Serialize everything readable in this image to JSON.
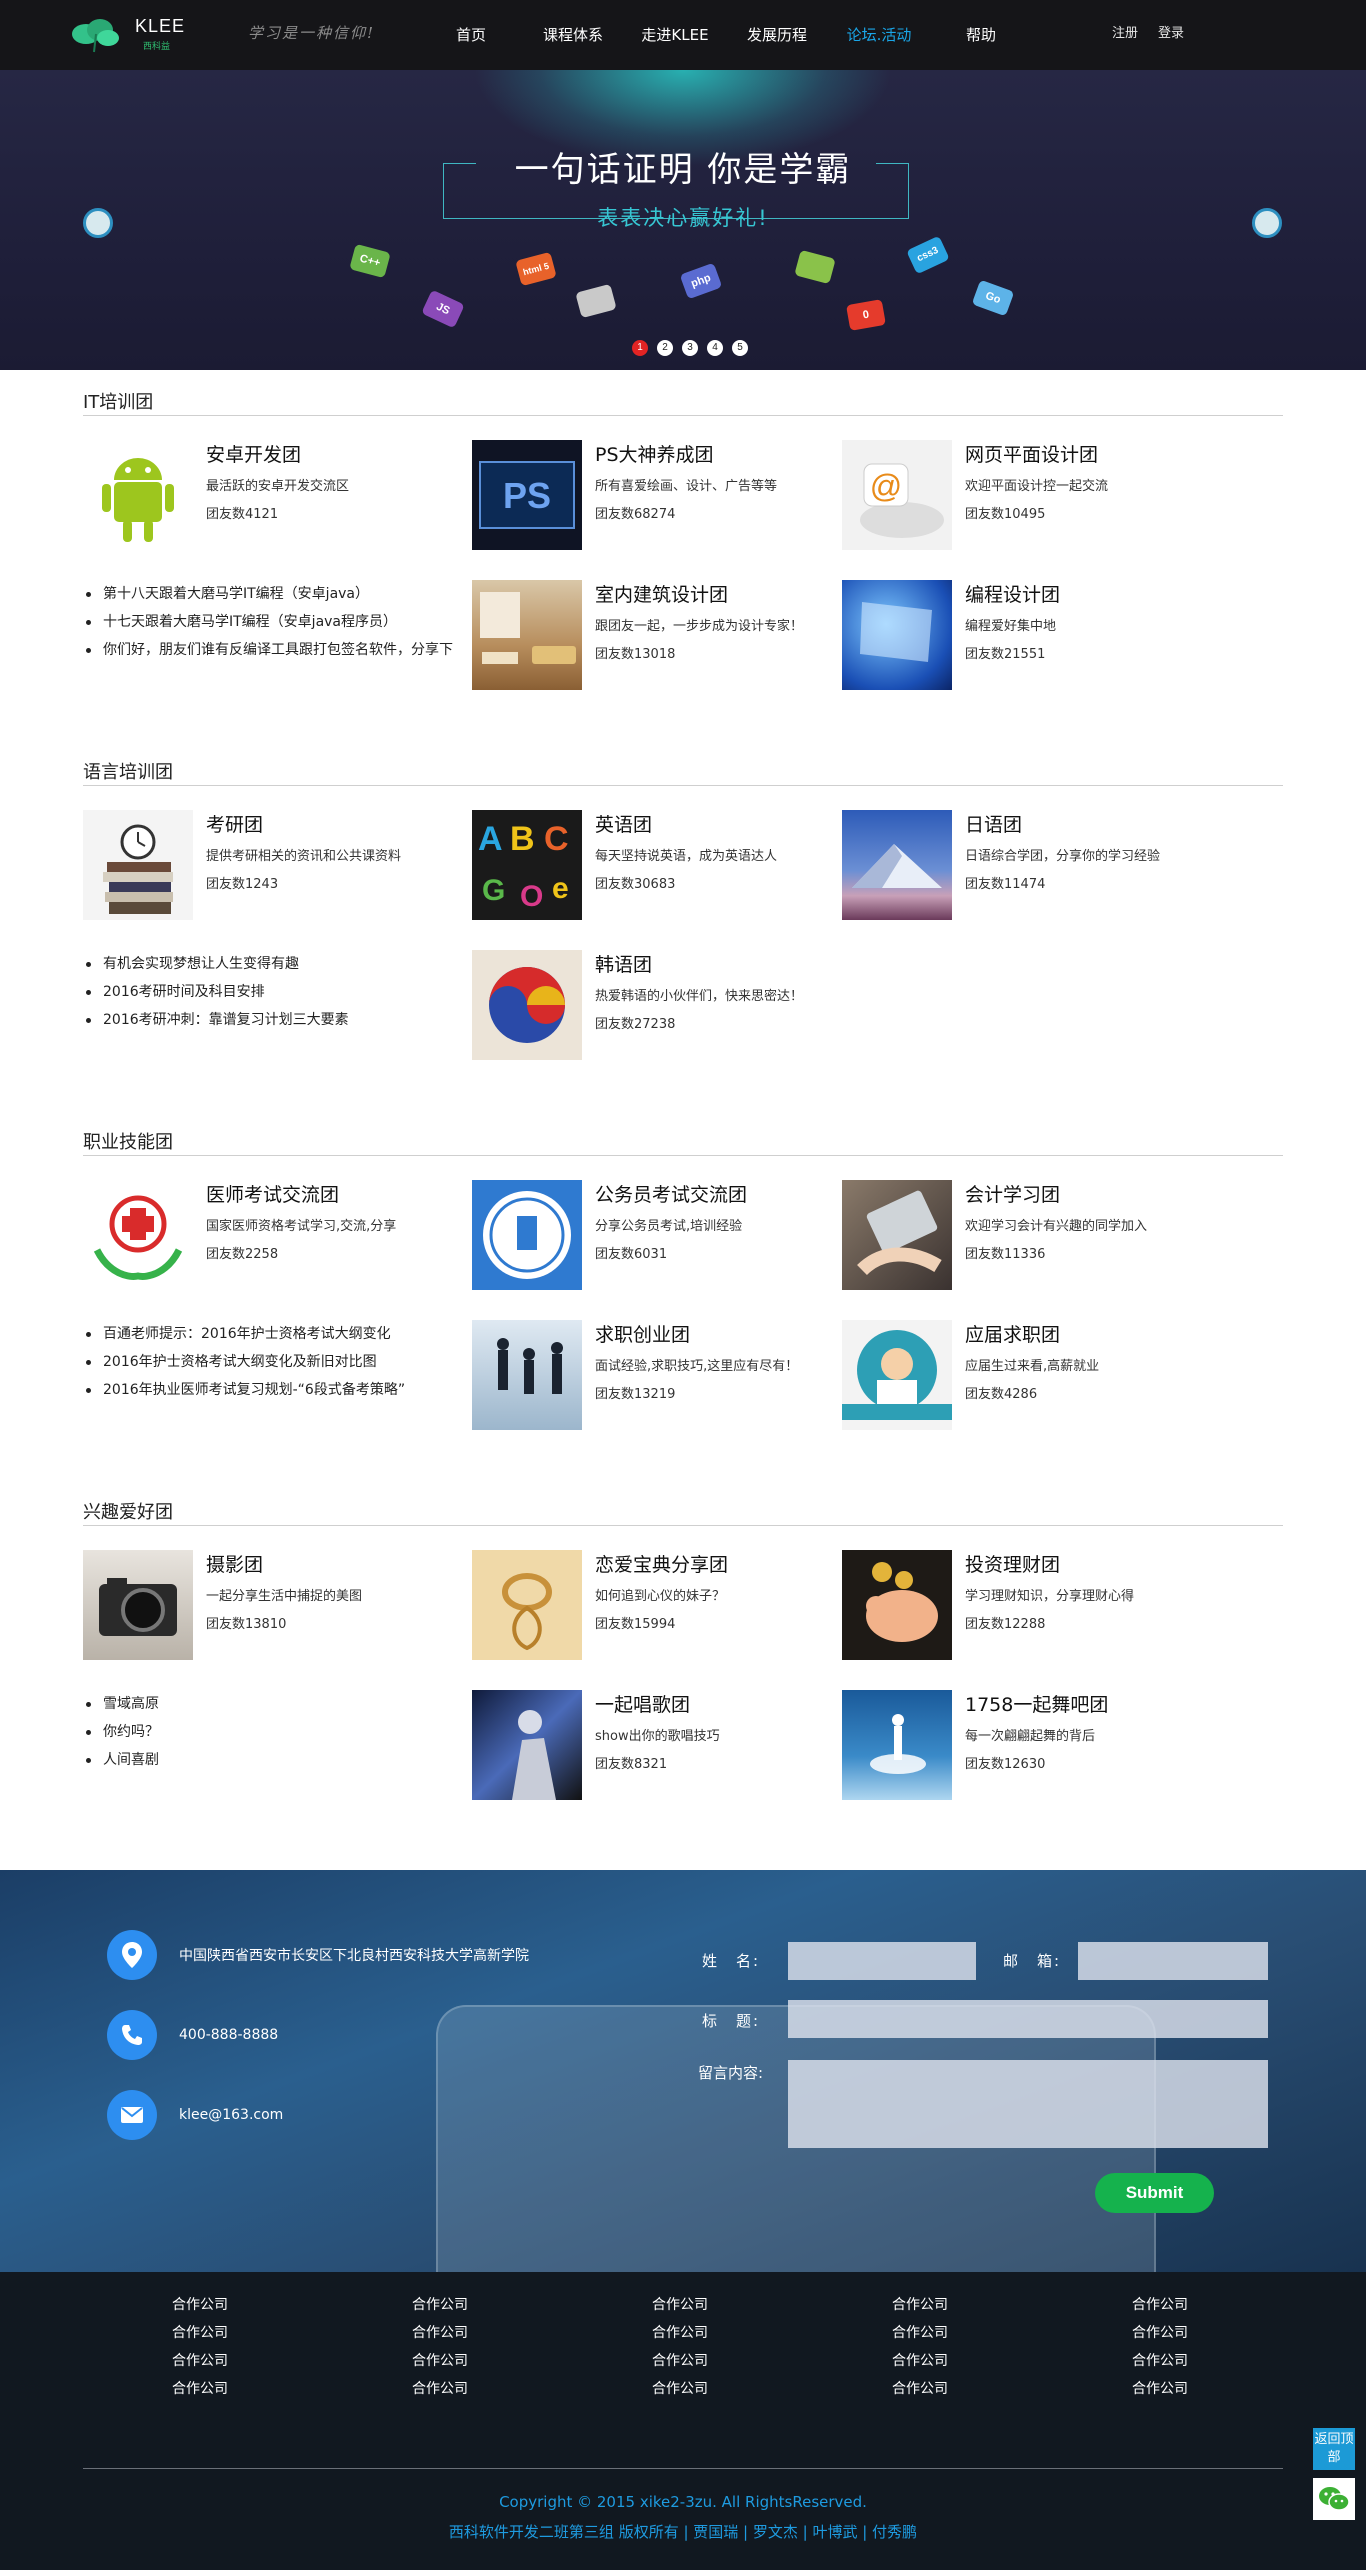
{
  "nav": {
    "logo_text": "KLEE",
    "logo_sub": "西科益",
    "slogan": "学习是一种信仰!",
    "menu": [
      "首页",
      "课程体系",
      "走进KLEE",
      "发展历程",
      "论坛.活动",
      "帮助"
    ],
    "active_menu": "论坛.活动",
    "register": "注册",
    "login": "登录"
  },
  "banner": {
    "title": "一句话证明 你是学霸",
    "subtitle": "表表决心赢好礼!",
    "tags": [
      "C++",
      "JS",
      "html 5",
      "",
      "php",
      "",
      "0",
      "css3",
      "Go"
    ],
    "dots": [
      "1",
      "2",
      "3",
      "4",
      "5"
    ],
    "active_dot": "1"
  },
  "sections": [
    {
      "title": "IT培训团",
      "groups": [
        {
          "name": "安卓开发团",
          "desc": "最活跃的安卓开发交流区",
          "members": "团友数4121"
        },
        {
          "name": "PS大神养成团",
          "desc": "所有喜爱绘画、设计、广告等等",
          "members": "团友数68274"
        },
        {
          "name": "网页平面设计团",
          "desc": "欢迎平面设计控一起交流",
          "members": "团友数10495"
        },
        {
          "name": "室内建筑设计团",
          "desc": "跟团友一起，一步步成为设计专家！",
          "members": "团友数13018"
        },
        {
          "name": "编程设计团",
          "desc": "编程爱好集中地",
          "members": "团友数21551"
        }
      ],
      "news": [
        "第十八天跟着大磨马学IT编程（安卓java）",
        "十七天跟着大磨马学IT编程（安卓java程序员）",
        "你们好，朋友们谁有反编译工具跟打包签名软件，分享下"
      ]
    },
    {
      "title": "语言培训团",
      "groups": [
        {
          "name": "考研团",
          "desc": "提供考研相关的资讯和公共课资料",
          "members": "团友数1243"
        },
        {
          "name": "英语团",
          "desc": "每天坚持说英语，成为英语达人",
          "members": "团友数30683"
        },
        {
          "name": "日语团",
          "desc": "日语综合学团，分享你的学习经验",
          "members": "团友数11474"
        },
        {
          "name": "韩语团",
          "desc": "热爱韩语的小伙伴们，快来思密达！",
          "members": "团友数27238"
        }
      ],
      "news": [
        "有机会实现梦想让人生变得有趣",
        "2016考研时间及科目安排",
        "2016考研冲刺：靠谱复习计划三大要素"
      ]
    },
    {
      "title": "职业技能团",
      "groups": [
        {
          "name": "医师考试交流团",
          "desc": "国家医师资格考试学习,交流,分享",
          "members": "团友数2258"
        },
        {
          "name": "公务员考试交流团",
          "desc": "分享公务员考试,培训经验",
          "members": "团友数6031"
        },
        {
          "name": "会计学习团",
          "desc": "欢迎学习会计有兴趣的同学加入",
          "members": "团友数11336"
        },
        {
          "name": "求职创业团",
          "desc": "面试经验,求职技巧,这里应有尽有！",
          "members": "团友数13219"
        },
        {
          "name": "应届求职团",
          "desc": "应届生过来看,高薪就业",
          "members": "团友数4286"
        }
      ],
      "news": [
        "百通老师提示：2016年护士资格考试大纲变化",
        "2016年护士资格考试大纲变化及新旧对比图",
        "2016年执业医师考试复习规划-“6段式备考策略”"
      ]
    },
    {
      "title": "兴趣爱好团",
      "groups": [
        {
          "name": "摄影团",
          "desc": "一起分享生活中捕捉的美图",
          "members": "团友数13810"
        },
        {
          "name": "恋爱宝典分享团",
          "desc": "如何追到心仪的妹子？",
          "members": "团友数15994"
        },
        {
          "name": "投资理财团",
          "desc": "学习理财知识，分享理财心得",
          "members": "团友数12288"
        },
        {
          "name": "一起唱歌团",
          "desc": "show出你的歌唱技巧",
          "members": "团友数8321"
        },
        {
          "name": "1758一起舞吧团",
          "desc": "每一次翩翩起舞的背后",
          "members": "团友数12630"
        }
      ],
      "news": [
        "雪域高原",
        "你约吗？",
        "人间喜剧"
      ]
    }
  ],
  "contact": {
    "address": "中国陕西省西安市长安区下北良村西安科技大学高新学院",
    "phone": "400-888-8888",
    "email": "klee@163.com",
    "form": {
      "name_label": "姓　名:",
      "email_label": "邮　箱:",
      "subject_label": "标　题:",
      "message_label": "留言内容:",
      "submit": "Submit"
    }
  },
  "partners": {
    "label": "合作公司",
    "columns": [
      [
        "合作公司",
        "合作公司",
        "合作公司",
        "合作公司"
      ],
      [
        "合作公司",
        "合作公司",
        "合作公司",
        "合作公司"
      ],
      [
        "合作公司",
        "合作公司",
        "合作公司",
        "合作公司"
      ],
      [
        "合作公司",
        "合作公司",
        "合作公司",
        "合作公司"
      ],
      [
        "合作公司",
        "合作公司",
        "合作公司",
        "合作公司"
      ]
    ]
  },
  "footer": {
    "copyright": "Copyright © 2015 xike2-3zu. All RightsReserved.",
    "credits": "西科软件开发二班第三组 版权所有 | 贾国瑞 | 罗文杰 | 叶博武 | 付秀鹏",
    "back_to_top": "返回顶部"
  },
  "colors": {
    "nav_bg": "#151518",
    "accent": "#1aa6e8",
    "banner_bg": "#1f1f3a",
    "submit_green": "#15b24d",
    "footer_text": "#1e9be0"
  }
}
